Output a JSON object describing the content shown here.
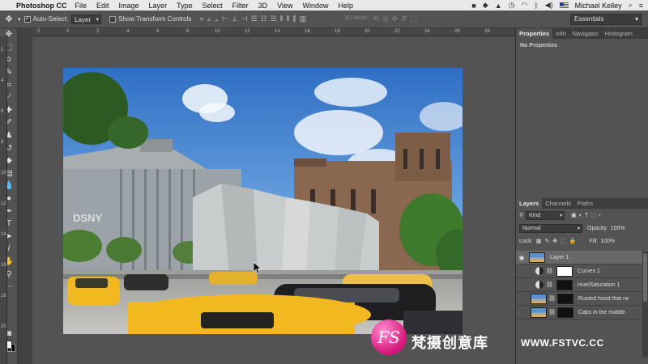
{
  "menubar": {
    "app": "Photoshop CC",
    "items": [
      "File",
      "Edit",
      "Image",
      "Layer",
      "Type",
      "Select",
      "Filter",
      "3D",
      "View",
      "Window",
      "Help"
    ],
    "user": "Michael Kelley"
  },
  "options": {
    "auto_select_label": "Auto-Select:",
    "auto_select_value": "Layer",
    "show_transform_label": "Show Transform Controls",
    "mode_3d_label": "3D Mode:",
    "workspace": "Essentials"
  },
  "ruler": {
    "top_ticks": [
      "2",
      "0",
      "2",
      "4",
      "6",
      "8",
      "10",
      "12",
      "14",
      "16",
      "18",
      "20",
      "22",
      "24",
      "26",
      "28"
    ],
    "side_ticks": [
      "2",
      "4",
      "6",
      "8",
      "10",
      "12",
      "14",
      "16",
      "18",
      "20"
    ]
  },
  "panels": {
    "top_tabs": [
      "Properties",
      "Info",
      "Navigator",
      "Histogram"
    ],
    "no_properties": "No Properties",
    "layer_tabs": [
      "Layers",
      "Channels",
      "Paths"
    ],
    "filter_kind": "Kind",
    "blend_mode": "Normal",
    "opacity_label": "Opacity:",
    "opacity_value": "100%",
    "lock_label": "Lock:",
    "fill_label": "Fill:",
    "fill_value": "100%"
  },
  "layers": [
    {
      "name": "Layer 1",
      "selected": true
    },
    {
      "name": "Curves 1",
      "selected": false
    },
    {
      "name": "Hue/Saturation 1",
      "selected": false
    },
    {
      "name": "Rusted hood that nee...",
      "selected": false
    },
    {
      "name": "Cabs in the middle",
      "selected": false
    }
  ],
  "photo": {
    "sign_text": "DSNY"
  },
  "watermark": {
    "logo_text": "FS",
    "cn_text": "梵摄创意库",
    "url_text": "WWW.FSTVC.CC"
  },
  "colors": {
    "ui_bg": "#535353",
    "panel_dark": "#3d3d3d",
    "selected_layer": "#686868",
    "taxi_yellow": "#f2b81f",
    "sky_blue": "#3c7fcf",
    "watermark_pink": "#d4157a"
  },
  "icons": {
    "toolbar": [
      "move-icon",
      "marquee-icon",
      "lasso-icon",
      "quick-select-icon",
      "crop-icon",
      "eyedropper-icon",
      "healing-icon",
      "brush-icon",
      "clone-stamp-icon",
      "history-brush-icon",
      "eraser-icon",
      "gradient-icon",
      "blur-icon",
      "dodge-icon",
      "pen-icon",
      "type-icon",
      "path-select-icon",
      "rectangle-icon",
      "hand-icon",
      "zoom-icon",
      "more-icon"
    ]
  }
}
